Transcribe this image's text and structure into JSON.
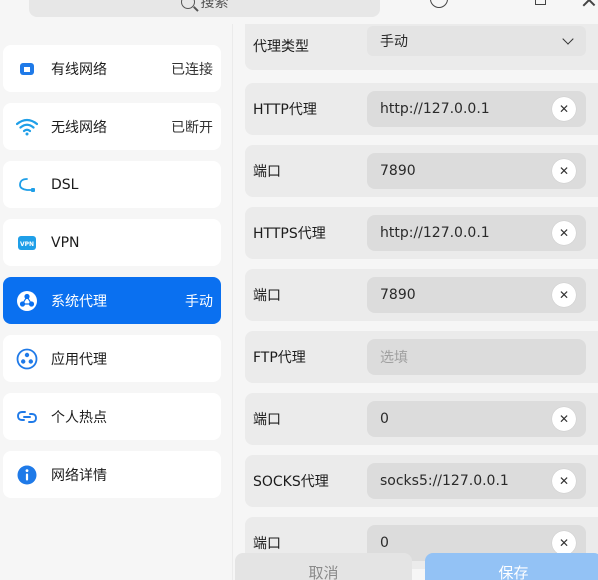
{
  "topbar": {
    "search_label": "搜索",
    "search_icon": "search-icon"
  },
  "sidebar": {
    "items": [
      {
        "label": "有线网络",
        "status": "已连接",
        "icon": "wired-network-icon",
        "icon_color": "#1f7ae8"
      },
      {
        "label": "无线网络",
        "status": "已断开",
        "icon": "wifi-icon",
        "icon_color": "#1f9fe8"
      },
      {
        "label": "DSL",
        "status": "",
        "icon": "dsl-cable-icon",
        "icon_color": "#1f9fe8"
      },
      {
        "label": "VPN",
        "status": "",
        "icon": "vpn-icon",
        "icon_color": "#1f9fe8"
      },
      {
        "label": "系统代理",
        "status": "手动",
        "icon": "system-proxy-icon",
        "icon_color": "#ffffff",
        "active": true
      },
      {
        "label": "应用代理",
        "status": "",
        "icon": "app-proxy-icon",
        "icon_color": "#1f7ae8"
      },
      {
        "label": "个人热点",
        "status": "",
        "icon": "hotspot-icon",
        "icon_color": "#1f7ae8"
      },
      {
        "label": "网络详情",
        "status": "",
        "icon": "info-icon",
        "icon_color": "#1f7ae8"
      }
    ]
  },
  "proxy": {
    "type_label": "代理类型",
    "type_value": "手动",
    "rows": [
      {
        "label": "HTTP代理",
        "value": "http://127.0.0.1",
        "placeholder": ""
      },
      {
        "label": "端口",
        "value": "7890",
        "placeholder": ""
      },
      {
        "label": "HTTPS代理",
        "value": "http://127.0.0.1",
        "placeholder": ""
      },
      {
        "label": "端口",
        "value": "7890",
        "placeholder": ""
      },
      {
        "label": "FTP代理",
        "value": "",
        "placeholder": "选填"
      },
      {
        "label": "端口",
        "value": "0",
        "placeholder": ""
      },
      {
        "label": "SOCKS代理",
        "value": "socks5://127.0.0.1",
        "placeholder": ""
      },
      {
        "label": "端口",
        "value": "0",
        "placeholder": ""
      }
    ]
  },
  "footer": {
    "cancel_label": "取消",
    "save_label": "保存"
  },
  "colors": {
    "accent": "#0a70f0",
    "save_button": "#93c2f5"
  }
}
